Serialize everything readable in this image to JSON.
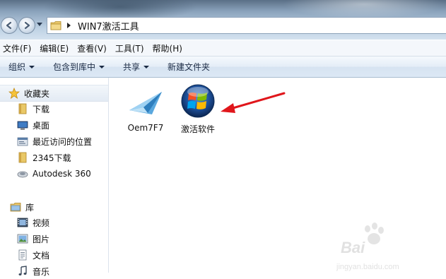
{
  "address": {
    "path": "WIN7激活工具"
  },
  "menu": [
    "文件(F)",
    "编辑(E)",
    "查看(V)",
    "工具(T)",
    "帮助(H)"
  ],
  "commands": [
    {
      "label": "组织",
      "dropdown": true
    },
    {
      "label": "包含到库中",
      "dropdown": true
    },
    {
      "label": "共享",
      "dropdown": true
    },
    {
      "label": "新建文件夹",
      "dropdown": false
    }
  ],
  "nav": {
    "favorites": {
      "label": "收藏夹",
      "items": [
        {
          "label": "下载",
          "icon": "download-folder-icon"
        },
        {
          "label": "桌面",
          "icon": "desktop-icon"
        },
        {
          "label": "最近访问的位置",
          "icon": "recent-places-icon"
        },
        {
          "label": "2345下载",
          "icon": "folder-icon"
        },
        {
          "label": "Autodesk 360",
          "icon": "cloud-icon"
        }
      ]
    },
    "libraries": {
      "label": "库",
      "items": [
        {
          "label": "视频",
          "icon": "video-library-icon"
        },
        {
          "label": "图片",
          "icon": "picture-library-icon"
        },
        {
          "label": "文档",
          "icon": "document-library-icon"
        },
        {
          "label": "音乐",
          "icon": "music-library-icon"
        }
      ]
    }
  },
  "files": [
    {
      "name": "Oem7F7",
      "icon": "paper-plane-icon"
    },
    {
      "name": "激活软件",
      "icon": "windows-orb-icon"
    }
  ],
  "colors": {
    "annotation_arrow": "#e0161b",
    "accent": "#1e5aa8"
  },
  "watermark": {
    "text": "Bai",
    "sub": "jingyan.baidu.com"
  }
}
